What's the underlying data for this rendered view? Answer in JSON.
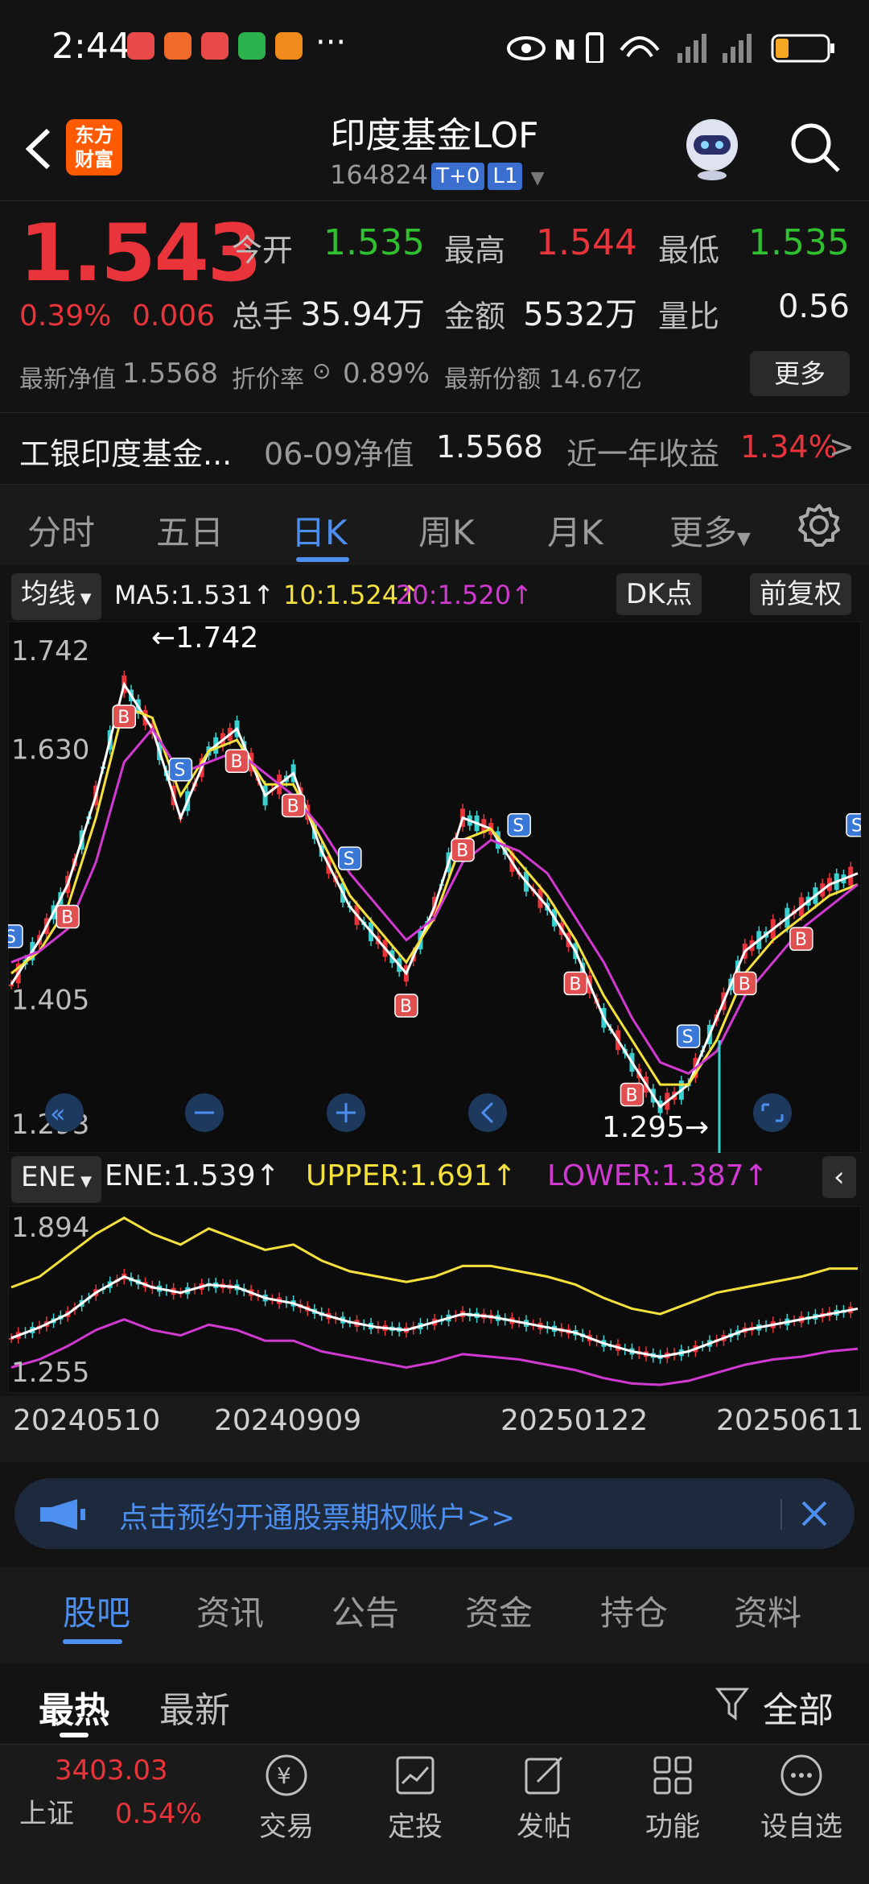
{
  "status": {
    "time": "2:44",
    "dots": "···"
  },
  "header": {
    "logo_line1": "东方",
    "logo_line2": "财富",
    "title": "印度基金LOF",
    "code": "164824",
    "tag1": "T+0",
    "tag2": "L1"
  },
  "quote": {
    "price": "1.543",
    "pct": "0.39%",
    "change": "0.006",
    "open_label": "今开",
    "open": "1.535",
    "high_label": "最高",
    "high": "1.544",
    "low_label": "最低",
    "low": "1.535",
    "vol_label": "总手",
    "vol": "35.94万",
    "amount_label": "金额",
    "amount": "5532万",
    "ratio_label": "量比",
    "ratio": "0.56",
    "nav_label": "最新净值",
    "nav": "1.5568",
    "discount_label": "折价率",
    "discount": "0.89%",
    "share_label": "最新份额",
    "share": "14.67亿",
    "more": "更多"
  },
  "fund": {
    "name": "工银印度基金...",
    "nav_date": "06-09净值",
    "nav": "1.5568",
    "year_label": "近一年收益",
    "year_return": "1.34%",
    "arrow": ">"
  },
  "tabs": [
    "分时",
    "五日",
    "日K",
    "周K",
    "月K",
    "更多"
  ],
  "chart_toolbar": {
    "ma_chip": "均线",
    "ma5": "MA5:1.531↑",
    "ma10": "10:1.524↑",
    "ma20": "20:1.520↑",
    "dk": "DK点",
    "fq": "前复权"
  },
  "ene": {
    "chip": "ENE",
    "ene": "ENE:1.539↑",
    "upper": "UPPER:1.691↑",
    "lower": "LOWER:1.387↑"
  },
  "chart_data": [
    {
      "type": "line",
      "title": "日K",
      "ylim": [
        1.293,
        1.742
      ],
      "y_ticks": [
        "1.742",
        "1.630",
        "1.405",
        "1.293"
      ],
      "annotations": [
        "←1.742",
        "1.295→"
      ],
      "series": [
        {
          "name": "MA5",
          "color": "#ffffff",
          "values": [
            1.43,
            1.47,
            1.52,
            1.6,
            1.7,
            1.66,
            1.58,
            1.64,
            1.66,
            1.6,
            1.62,
            1.55,
            1.5,
            1.47,
            1.44,
            1.5,
            1.58,
            1.57,
            1.53,
            1.5,
            1.46,
            1.4,
            1.36,
            1.32,
            1.34,
            1.4,
            1.46,
            1.48,
            1.5,
            1.52,
            1.53
          ]
        },
        {
          "name": "MA10",
          "color": "#f5e13c",
          "values": [
            1.44,
            1.46,
            1.5,
            1.58,
            1.68,
            1.67,
            1.6,
            1.64,
            1.65,
            1.61,
            1.61,
            1.56,
            1.51,
            1.48,
            1.45,
            1.49,
            1.56,
            1.57,
            1.54,
            1.51,
            1.47,
            1.42,
            1.38,
            1.34,
            1.34,
            1.38,
            1.44,
            1.47,
            1.49,
            1.51,
            1.52
          ]
        },
        {
          "name": "MA20",
          "color": "#d13ad1",
          "values": [
            1.45,
            1.46,
            1.48,
            1.54,
            1.63,
            1.66,
            1.62,
            1.63,
            1.64,
            1.62,
            1.6,
            1.57,
            1.53,
            1.5,
            1.47,
            1.49,
            1.54,
            1.56,
            1.55,
            1.53,
            1.49,
            1.45,
            1.4,
            1.36,
            1.35,
            1.37,
            1.42,
            1.45,
            1.48,
            1.5,
            1.52
          ]
        }
      ]
    },
    {
      "type": "line",
      "title": "ENE",
      "ylim": [
        1.255,
        1.894
      ],
      "y_ticks": [
        "1.894",
        "1.255"
      ],
      "x_ticks": [
        "20240510",
        "20240909",
        "20250122",
        "20250611"
      ],
      "series": [
        {
          "name": "ENE",
          "color": "#ffffff",
          "values": [
            1.43,
            1.47,
            1.52,
            1.6,
            1.66,
            1.62,
            1.6,
            1.63,
            1.62,
            1.58,
            1.56,
            1.52,
            1.49,
            1.47,
            1.46,
            1.49,
            1.52,
            1.51,
            1.49,
            1.47,
            1.45,
            1.41,
            1.38,
            1.36,
            1.38,
            1.42,
            1.46,
            1.48,
            1.5,
            1.52,
            1.54
          ]
        },
        {
          "name": "UPPER",
          "color": "#f5e13c",
          "values": [
            1.62,
            1.66,
            1.74,
            1.82,
            1.88,
            1.82,
            1.78,
            1.84,
            1.8,
            1.76,
            1.78,
            1.72,
            1.68,
            1.66,
            1.64,
            1.66,
            1.7,
            1.7,
            1.68,
            1.66,
            1.63,
            1.58,
            1.54,
            1.52,
            1.56,
            1.6,
            1.62,
            1.64,
            1.66,
            1.69,
            1.69
          ]
        },
        {
          "name": "LOWER",
          "color": "#d13ad1",
          "values": [
            1.32,
            1.35,
            1.4,
            1.46,
            1.5,
            1.46,
            1.44,
            1.48,
            1.46,
            1.42,
            1.42,
            1.38,
            1.36,
            1.34,
            1.32,
            1.34,
            1.37,
            1.36,
            1.35,
            1.33,
            1.31,
            1.28,
            1.26,
            1.255,
            1.27,
            1.3,
            1.33,
            1.35,
            1.36,
            1.38,
            1.39
          ]
        }
      ]
    }
  ],
  "banner": {
    "text": "点击预约开通股票期权账户>>"
  },
  "news_tabs": [
    "股吧",
    "资讯",
    "公告",
    "资金",
    "持仓",
    "资料"
  ],
  "sub_tabs": {
    "hot": "最热",
    "new": "最新",
    "filter": "全部"
  },
  "bottom": {
    "index_value": "3403.03",
    "index_name": "上证",
    "index_pct": "0.54%",
    "items": [
      "交易",
      "定投",
      "发帖",
      "功能",
      "设自选"
    ]
  },
  "colors": {
    "up": "#e8343a",
    "down": "#2ec02e",
    "accent": "#4d8ff0"
  }
}
